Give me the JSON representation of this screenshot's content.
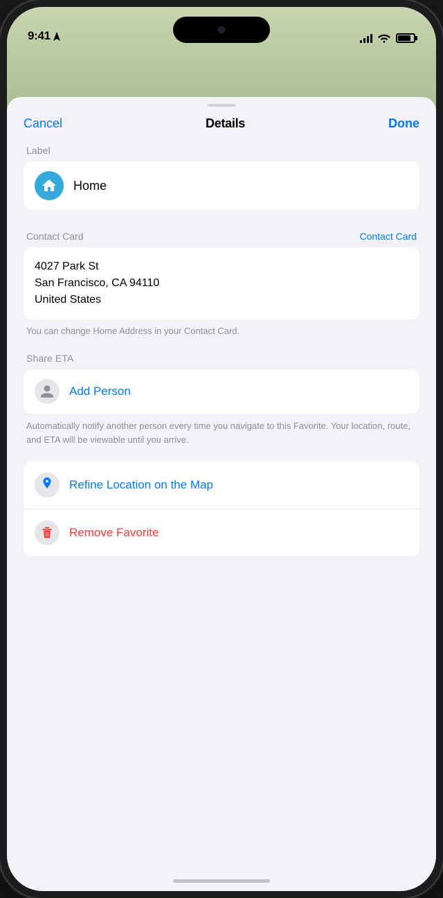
{
  "statusBar": {
    "time": "9:41",
    "hasLocation": true
  },
  "header": {
    "cancelLabel": "Cancel",
    "title": "Details",
    "doneLabel": "Done"
  },
  "labelSection": {
    "sectionTitle": "Label",
    "labelValue": "Home"
  },
  "contactCardSection": {
    "sectionTitle": "Contact Card",
    "linkLabel": "Contact Card",
    "addressLine1": "4027 Park St",
    "addressLine2": "San Francisco, CA 94110",
    "addressLine3": "United States",
    "hint": "You can change Home Address in your Contact Card."
  },
  "shareEtaSection": {
    "sectionTitle": "Share ETA",
    "addPersonLabel": "Add Person",
    "hint": "Automatically notify another person every time you navigate to this Favorite. Your location, route, and ETA will be viewable until you arrive."
  },
  "actions": {
    "refineLocation": "Refine Location on the Map",
    "removeFavorite": "Remove Favorite"
  }
}
